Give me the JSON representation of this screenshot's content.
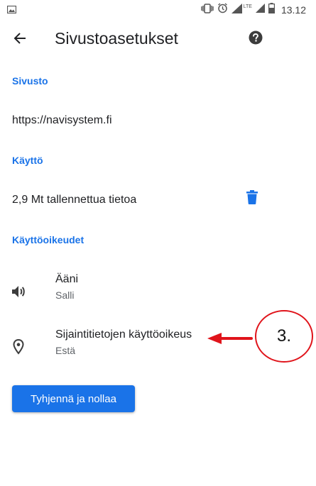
{
  "status_bar": {
    "time": "13.12",
    "network": "LTE",
    "icons": [
      "gallery-icon",
      "vibrate-icon",
      "alarm-icon",
      "signal-icon",
      "battery-icon"
    ]
  },
  "app_bar": {
    "title": "Sivustoasetukset",
    "icons": [
      "back-arrow-icon",
      "help-icon"
    ]
  },
  "site_section": {
    "header": "Sivusto",
    "url": "https://navisystem.fi"
  },
  "usage_section": {
    "header": "Käyttö",
    "storage_text": "2,9 Mt tallennettua tietoa",
    "icon": "trash-icon"
  },
  "permissions_section": {
    "header": "Käyttöoikeudet",
    "items": [
      {
        "title": "Ääni",
        "status": "Salli",
        "icon": "speaker-icon"
      },
      {
        "title": "Sijaintitietojen käyttöoikeus",
        "status": "Estä",
        "icon": "location-pin-icon"
      }
    ]
  },
  "reset_button": {
    "label": "Tyhjennä ja nollaa"
  },
  "annotation": {
    "label": "3."
  },
  "colors": {
    "accent": "#1a73e8",
    "annotation_red": "#e0141b",
    "text_primary": "#202124",
    "text_secondary": "#5f6368"
  }
}
